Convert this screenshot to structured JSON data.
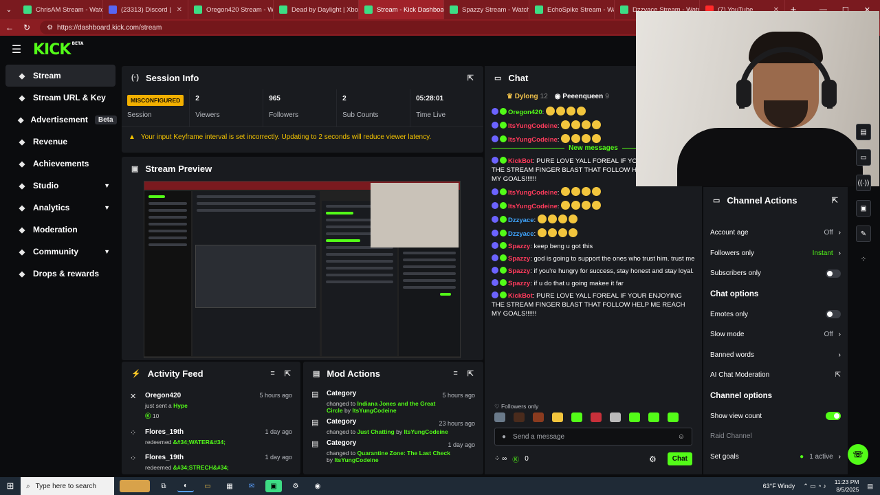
{
  "browser": {
    "tabs": [
      {
        "label": "ChrisAM Stream - Watc",
        "active": false
      },
      {
        "label": "(23313) Discord |",
        "active": false
      },
      {
        "label": "Oregon420 Stream - W",
        "active": false
      },
      {
        "label": "Dead by Daylight | Xbo",
        "active": false
      },
      {
        "label": "Stream - Kick Dashboa",
        "active": true
      },
      {
        "label": "Spazzy Stream - Watch",
        "active": false
      },
      {
        "label": "EchoSpike Stream - Wa",
        "active": false
      },
      {
        "label": "Dzzyace Stream - Watc",
        "active": false
      },
      {
        "label": "(7) YouTube",
        "active": false
      }
    ],
    "url": "https://dashboard.kick.com/stream"
  },
  "brand": {
    "logo": "KICK",
    "logo_tag": "BETA",
    "accent": "#53fc18"
  },
  "sidebar": {
    "items": [
      {
        "label": "Stream",
        "icon": "broadcast-icon",
        "active": true
      },
      {
        "label": "Stream URL & Key",
        "icon": "link-icon"
      },
      {
        "label": "Advertisement",
        "icon": "megaphone-icon",
        "badge": "Beta"
      },
      {
        "label": "Revenue",
        "icon": "revenue-icon"
      },
      {
        "label": "Achievements",
        "icon": "trophy-icon"
      },
      {
        "label": "Studio",
        "icon": "studio-icon",
        "chevron": true
      },
      {
        "label": "Analytics",
        "icon": "analytics-icon",
        "chevron": true
      },
      {
        "label": "Moderation",
        "icon": "wrench-icon"
      },
      {
        "label": "Community",
        "icon": "community-icon",
        "chevron": true
      },
      {
        "label": "Drops & rewards",
        "icon": "gift-icon"
      }
    ]
  },
  "session": {
    "title": "Session Info",
    "status_badge": "MISCONFIGURED",
    "stats": [
      {
        "label": "Session",
        "value": ""
      },
      {
        "label": "Viewers",
        "value": "2"
      },
      {
        "label": "Followers",
        "value": "965"
      },
      {
        "label": "Sub Counts",
        "value": "2"
      },
      {
        "label": "Time Live",
        "value": "05:28:01"
      }
    ],
    "warning": "Your input Keyframe interval is set incorrectly. Updating to 2 seconds will reduce viewer latency."
  },
  "preview": {
    "title": "Stream Preview"
  },
  "activity": {
    "title": "Activity Feed",
    "items": [
      {
        "name": "Oregon420",
        "line1": "just sent a ",
        "highlight": "Hype",
        "extra": "10",
        "time": "5 hours ago"
      },
      {
        "name": "Flores_19th",
        "line1": "redeemed ",
        "highlight": "&#34;WATER&#34;",
        "extra": "",
        "time": "1 day ago"
      },
      {
        "name": "Flores_19th",
        "line1": "redeemed ",
        "highlight": "&#34;STRECH&#34;",
        "extra": "",
        "time": "1 day ago"
      }
    ]
  },
  "mod": {
    "title": "Mod Actions",
    "items": [
      {
        "name": "Category",
        "line1": "changed to ",
        "highlight": "Indiana Jones and the Great Circle",
        "by": " by ",
        "user": "ItsYungCodeine",
        "time": "5 hours ago"
      },
      {
        "name": "Category",
        "line1": "changed to ",
        "highlight": "Just Chatting",
        "by": " by ",
        "user": "ItsYungCodeine",
        "time": "23 hours ago"
      },
      {
        "name": "Category",
        "line1": "changed to ",
        "highlight": "Quarantine Zone: The Last Check",
        "by": " by ",
        "user": "ItsYungCodeine",
        "time": "1 day ago"
      }
    ]
  },
  "chat": {
    "title": "Chat",
    "top": [
      {
        "name": "Dylong",
        "count": "12"
      },
      {
        "name": "Peeenqueen",
        "count": "9"
      }
    ],
    "messages_before": [
      {
        "user": "Oregon420",
        "color": "green",
        "text": ": "
      },
      {
        "user": "ItsYungCodeine",
        "color": "red",
        "text": ":"
      },
      {
        "user": "ItsYungCodeine",
        "color": "red",
        "text": ":"
      }
    ],
    "new_label": "New messages",
    "messages_after": [
      {
        "user": "KickBot",
        "color": "red",
        "text": ": PURE LOVE YALL FOREAL IF YOUR ENJOYING THE STREAM FINGER BLAST THAT FOLLOW HELP ME REACH MY GOALS!!!!!!"
      },
      {
        "user": "ItsYungCodeine",
        "color": "red",
        "text": ":"
      },
      {
        "user": "ItsYungCodeine",
        "color": "red",
        "text": ":"
      },
      {
        "user": "Dzzyace",
        "color": "blue",
        "text": ":"
      },
      {
        "user": "Dzzyace",
        "color": "blue",
        "text": ":"
      },
      {
        "user": "Spazzy",
        "color": "red",
        "text": ": keep beng u got this"
      },
      {
        "user": "Spazzy",
        "color": "red",
        "text": ": god is going to support the ones who trust him. trust me"
      },
      {
        "user": "Spazzy",
        "color": "red",
        "text": ": if you're hungry for success, stay honest and stay loyal."
      },
      {
        "user": "Spazzy",
        "color": "red",
        "text": ": if u do that u going makee it far"
      },
      {
        "user": "KickBot",
        "color": "red",
        "text": ": PURE LOVE YALL FOREAL IF YOUR ENJOYING THE STREAM FINGER BLAST THAT FOLLOW HELP ME REACH MY GOALS!!!!!!"
      }
    ],
    "followers_only": "Followers only",
    "send_placeholder": "Send a message",
    "count": "0",
    "chat_button": "Chat"
  },
  "channel_actions": {
    "title": "Channel Actions",
    "rows": [
      {
        "label": "Account age",
        "value": "Off",
        "type": "chevron"
      },
      {
        "label": "Followers only",
        "value": "Instant",
        "type": "chevron-green"
      },
      {
        "label": "Subscribers only",
        "value": "",
        "type": "toggle-off"
      }
    ],
    "chat_options_title": "Chat options",
    "chat_rows": [
      {
        "label": "Emotes only",
        "value": "",
        "type": "toggle-off"
      },
      {
        "label": "Slow mode",
        "value": "Off",
        "type": "chevron"
      },
      {
        "label": "Banned words",
        "value": "",
        "type": "chevron"
      },
      {
        "label": "AI Chat Moderation",
        "value": "",
        "type": "external"
      }
    ],
    "channel_options_title": "Channel options",
    "channel_rows": [
      {
        "label": "Show view count",
        "value": "",
        "type": "toggle-on"
      },
      {
        "label": "Raid Channel",
        "value": "",
        "type": "disabled"
      },
      {
        "label": "Set goals",
        "value": "1 active",
        "type": "chevron-dot"
      }
    ]
  },
  "taskbar": {
    "search_placeholder": "Type here to search",
    "weather": "63°F  Windy",
    "time": "11:23 PM",
    "date": "8/5/2025"
  }
}
